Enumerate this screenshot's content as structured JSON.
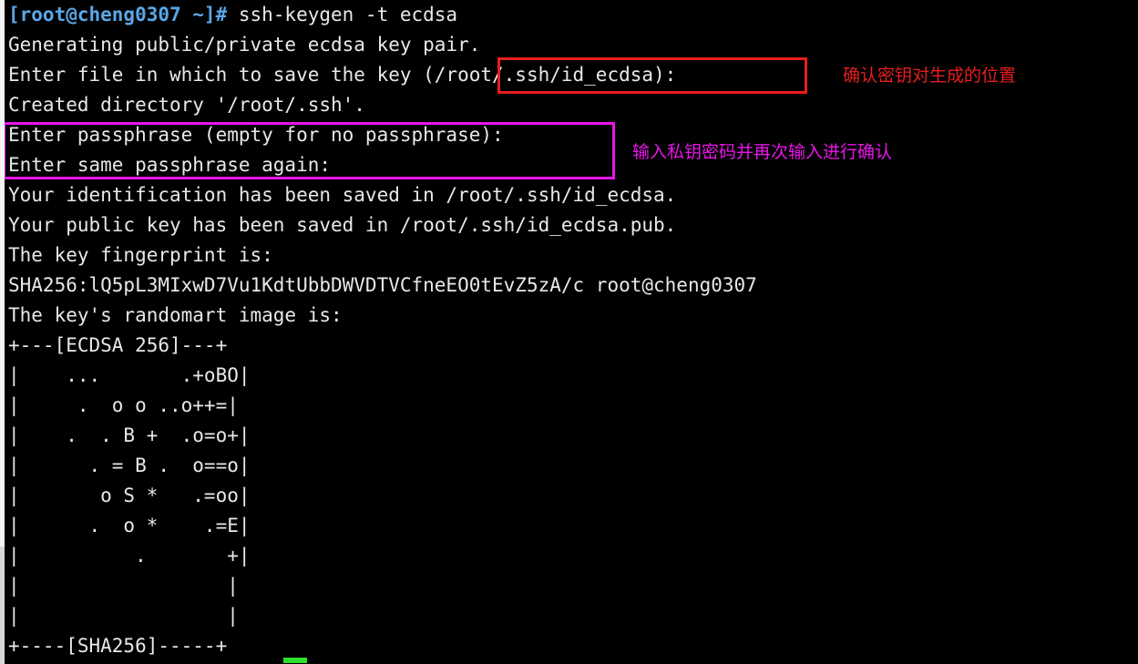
{
  "terminal": {
    "background_color": "#000000",
    "foreground_color": "#e8e8e8",
    "prompt_color": "#5aa7e8",
    "title": "root@cheng0307 terminal",
    "prompt": "[root@cheng0307 ~]#",
    "command": " ssh-keygen -t ecdsa",
    "lines": [
      "Generating public/private ecdsa key pair.",
      "Enter file in which to save the key (/root/.ssh/id_ecdsa): ",
      "Created directory '/root/.ssh'.",
      "Enter passphrase (empty for no passphrase): ",
      "Enter same passphrase again: ",
      "Your identification has been saved in /root/.ssh/id_ecdsa.",
      "Your public key has been saved in /root/.ssh/id_ecdsa.pub.",
      "The key fingerprint is:",
      "SHA256:lQ5pL3MIxwD7Vu1KdtUbbDWVDTVCfneEO0tEvZ5zA/c root@cheng0307",
      "The key's randomart image is:"
    ],
    "randomart": [
      "+---[ECDSA 256]---+",
      "|     ...      .+oBO|",
      "|      . o o ..o++=|",
      "|     . . B + .o=o+|",
      "|      . = B .  o==o|",
      "|       o S *   .=oo|",
      "|      . o *     .=E|",
      "|         .         +|",
      "|                   |",
      "|                   |",
      "+----[SHA256]-----+"
    ],
    "randomart_rows": [
      "+---[ECDSA 256]---+",
      "|     ...       .+oBO|",
      "|      .  o o  ..o++=|",
      "|     .  . B +  .o=o+|",
      "|       . = B .  o==o|",
      "|        o S *   .=oo|",
      "|       .  o *     .=E|",
      "|           .        +|",
      "|                    |",
      "|                    |",
      "+----[SHA256]-----+"
    ]
  },
  "annotations": {
    "file_path_box": {
      "label": "file-path-highlight",
      "color": "#e81d1d",
      "note": "确认密钥对生成的位置"
    },
    "passphrase_box": {
      "label": "passphrase-highlight",
      "color": "#e815e8",
      "note": "输入私钥密码并再次输入进行确认"
    }
  },
  "randomart_art_lines": {
    "header": "+---[ECDSA 256]---+",
    "r1": "|     ...       .+oBO|",
    "r2": "|      .  o o  ..o++=|",
    "r3": "|     .  . B +  .o=o+|",
    "r4": "|       . = B .  o==o|",
    "r5": "|        o S *   .=oo|",
    "r6": "|       .  o *     .=E|",
    "r7": "|           .        +|",
    "r8": "|                    |",
    "r9": "|                    |",
    "footer": "+----[SHA256]-----+"
  },
  "art": {
    "header": "+---[ECDSA 256]---+",
    "rows": [
      "|    ...       .+oBO|",
      "|     .  o o ..o++=|",
      "|    .  . B +  .o=o+|",
      "|      . = B .  o==o|",
      "|       o S *   .=oo|",
      "|      .  o *    .=E|",
      "|          .       +|",
      "|                  |",
      "|                  |"
    ],
    "footer": "+----[SHA256]-----+"
  }
}
